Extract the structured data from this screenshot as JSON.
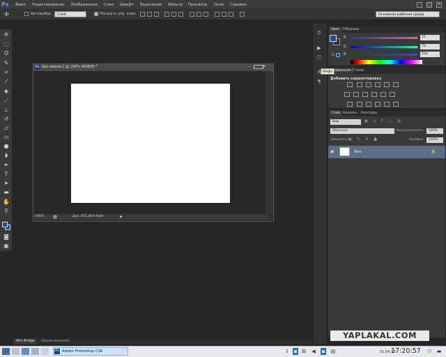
{
  "app": {
    "logo": "Ps"
  },
  "menu": [
    "Файл",
    "Редактирование",
    "Изображение",
    "Слои",
    "Шрифт",
    "Выделение",
    "Фильтр",
    "Просмотр",
    "Окно",
    "Справка"
  ],
  "window_controls": {
    "minimize": "–",
    "maximize": "□",
    "close": "✕"
  },
  "options": {
    "autoselect_label": "Автовыбор:",
    "autoselect_value": "Слой",
    "show_transform_label": "Показать упр. элем.",
    "workspace": "Основная рабочая среда"
  },
  "document": {
    "title": "Без имени-1 @ 100% (RGB/8) *",
    "zoom": "100%",
    "info": "Док: 452,2К/0 байт"
  },
  "tooltip": "Инфо",
  "color_panel": {
    "tabs": [
      "Цвет",
      "Образцы"
    ],
    "sliders": [
      {
        "label": "R",
        "value": "25"
      },
      {
        "label": "G",
        "value": "79"
      },
      {
        "label": "B",
        "value": "164"
      }
    ],
    "color": "#194fa4"
  },
  "adjustments_panel": {
    "tabs": [
      "Коррекция",
      "Стили"
    ],
    "heading": "Добавить корректировку"
  },
  "layers_panel": {
    "tabs": [
      "Слои",
      "Каналы",
      "Контуры"
    ],
    "kind": "Вид",
    "blend_mode": "Обычные",
    "opacity_label": "Непрозрачность:",
    "opacity": "100%",
    "lock_label": "Закрепить:",
    "fill_label": "Заливка:",
    "fill": "100%",
    "layer_name": "Фон"
  },
  "bottom_tabs": [
    "Mini Bridge",
    "Шкала времени"
  ],
  "watermark": "YAPLAKAL.COM",
  "taskbar": {
    "app_label": "Adobe Photoshop CS6",
    "date": "02.04.17",
    "time": "17:20:57"
  }
}
